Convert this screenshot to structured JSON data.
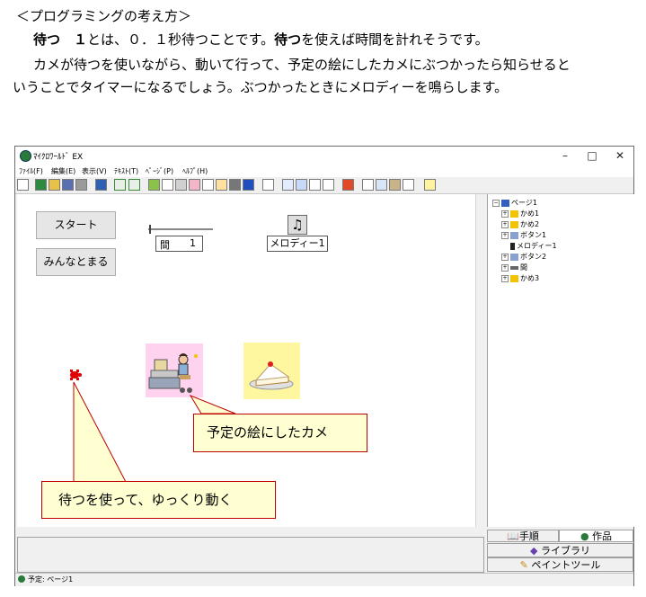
{
  "document": {
    "line1": "＜プログラミングの考え方＞",
    "line2_bold1": "待つ　１",
    "line2_text1": "とは、０．１秒待つことです。",
    "line2_bold2": "待つ",
    "line2_text2": "を使えば時間を計れそうです。",
    "line3": "カメが待つを使いながら、動いて行って、予定の絵にしたカメにぶつかったら知らせると",
    "line4": "いうことでタイマーになるでしょう。ぶつかったときにメロディーを鳴らします。"
  },
  "window": {
    "title": "ﾏｲｸﾛﾜｰﾙﾄﾞ EX",
    "controls": {
      "minimize": "–",
      "maximize": "□",
      "close": "✕"
    },
    "menu": [
      "ﾌｧｲﾙ(F)",
      "編集(E)",
      "表示(V)",
      "ﾃｷｽﾄ(T)",
      "ﾍﾟｰｼﾞ(P)",
      "ﾍﾙﾌﾟ(H)"
    ]
  },
  "stage": {
    "start_button": "スタート",
    "stop_all_button": "みんなとまる",
    "timer_label": "間",
    "timer_value": "1",
    "melody_label": "メロディー1"
  },
  "tree": {
    "root": "ページ1",
    "items": [
      "かめ1",
      "かめ2",
      "ボタン1",
      "メロディー1",
      "ボタン2",
      "間",
      "かめ3"
    ]
  },
  "callouts": {
    "scheduled": "予定の絵にしたカメ",
    "slow": "待つを使って、ゆっくり動く"
  },
  "tabs": {
    "procedure": "手順",
    "work": "作品",
    "library": "ライブラリ",
    "paint": "ペイントツール"
  },
  "status": "予定: ページ1",
  "colors": {
    "callout_border": "#c00000",
    "callout_fill": "#ffffd2",
    "turtle": "#e00000"
  }
}
